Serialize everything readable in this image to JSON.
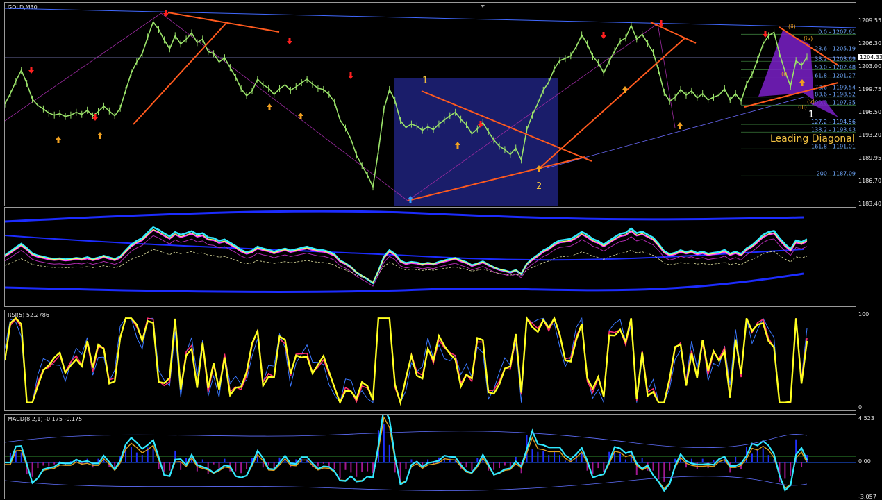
{
  "app": {
    "price_chart_label": "GOLD,M30",
    "rsi_label": "RSI(5) 52.2786",
    "macd_label": "MACD(8,2,1) -0.175 -0.175",
    "current_price": "1204.33"
  },
  "price_axis": [
    "1209.55",
    "1206.30",
    "1203.00",
    "1199.75",
    "1196.50",
    "1193.20",
    "1189.95",
    "1186.70",
    "1183.40"
  ],
  "rsi_axis": [
    "100",
    "0"
  ],
  "macd_axis": [
    "4.523",
    "0.00",
    "-3.057"
  ],
  "annotations": {
    "wave_1": "1",
    "wave_2": "2",
    "wave_i": "(i)",
    "wave_ii": "(ii)",
    "wave_iii": "(iii)",
    "wave_iv": "(iv)",
    "wave_v": "(v)",
    "big_1": "1",
    "leading_diagonal": "Leading Diagonal"
  },
  "fib_levels": [
    {
      "label": "0.0 - 1207.61",
      "price": 1207.61
    },
    {
      "label": "23.6 - 1205.19",
      "price": 1205.19
    },
    {
      "label": "38.2 - 1203.69",
      "price": 1203.69
    },
    {
      "label": "50.0 - 1202.48",
      "price": 1202.48
    },
    {
      "label": "61.8 - 1201.27",
      "price": 1201.27
    },
    {
      "label": "78.6 - 1199.54",
      "price": 1199.54
    },
    {
      "label": "88.6 - 1198.52",
      "price": 1198.52
    },
    {
      "label": "100.0 - 1197.35",
      "price": 1197.35
    },
    {
      "label": "127.2 - 1194.56",
      "price": 1194.56
    },
    {
      "label": "138.2 - 1193.43",
      "price": 1193.43
    },
    {
      "label": "161.8 - 1191.01",
      "price": 1191.01
    },
    {
      "label": "200 - 1187.09",
      "price": 1187.09
    }
  ],
  "chart_data": {
    "type": "line",
    "symbol": "GOLD",
    "timeframe": "M30",
    "ylim": [
      1183.4,
      1210.8
    ],
    "colors": {
      "candles": "#9be36a",
      "trendlines": "#ff5a1e",
      "fib": "#6fa8ff",
      "box": "#1a1d6a",
      "axis_line": "#4169ff"
    },
    "series": [
      {
        "values": [
          1197.5,
          1199.0,
          1200.8,
          1202.4,
          1200.5,
          1198.2,
          1197.3,
          1196.8,
          1196.2,
          1195.9,
          1196.1,
          1195.7,
          1195.9,
          1196.3,
          1196.0,
          1196.6,
          1195.8,
          1196.4,
          1197.2,
          1196.5,
          1195.8,
          1196.9,
          1199.5,
          1202.0,
          1203.6,
          1204.8,
          1207.2,
          1209.4,
          1208.3,
          1206.8,
          1205.5,
          1207.4,
          1206.2,
          1206.9,
          1207.8,
          1206.4,
          1206.9,
          1205.1,
          1204.8,
          1203.6,
          1204.2,
          1202.8,
          1201.4,
          1199.7,
          1198.7,
          1199.4,
          1201.1,
          1200.3,
          1199.8,
          1198.9,
          1199.7,
          1200.3,
          1199.5,
          1200.0,
          1200.6,
          1201.1,
          1200.4,
          1199.8,
          1199.6,
          1198.9,
          1197.8,
          1195.2,
          1194.0,
          1192.4,
          1190.1,
          1188.6,
          1187.2,
          1185.5,
          1190.7,
          1196.8,
          1199.6,
          1198.0,
          1195.1,
          1194.1,
          1194.6,
          1194.3,
          1193.7,
          1194.2,
          1193.8,
          1194.6,
          1195.2,
          1195.8,
          1196.3,
          1195.3,
          1194.5,
          1193.2,
          1193.9,
          1194.8,
          1193.5,
          1192.3,
          1191.4,
          1190.9,
          1190.2,
          1191.1,
          1189.4,
          1193.8,
          1195.9,
          1197.6,
          1199.5,
          1200.7,
          1202.6,
          1203.8,
          1204.1,
          1204.5,
          1205.8,
          1207.5,
          1206.2,
          1204.4,
          1203.5,
          1202.0,
          1203.7,
          1205.2,
          1206.6,
          1207.1,
          1208.9,
          1206.9,
          1207.6,
          1206.3,
          1205.0,
          1202.3,
          1199.2,
          1197.9,
          1198.5,
          1199.6,
          1198.8,
          1199.4,
          1198.4,
          1199.0,
          1198.1,
          1198.5,
          1198.8,
          1199.7,
          1198.1,
          1199.0,
          1197.9,
          1200.4,
          1201.8,
          1203.9,
          1206.2,
          1207.4,
          1207.9,
          1204.8,
          1202.2,
          1200.1,
          1203.8,
          1203.1,
          1204.3
        ]
      }
    ],
    "rsi": {
      "name": "RSI(5)",
      "value": 52.2786,
      "ylim": [
        0,
        100
      ]
    },
    "macd": {
      "name": "MACD(8,2,1)",
      "values": [
        -0.175,
        -0.175
      ],
      "ylim": [
        -3.057,
        4.523
      ]
    }
  }
}
